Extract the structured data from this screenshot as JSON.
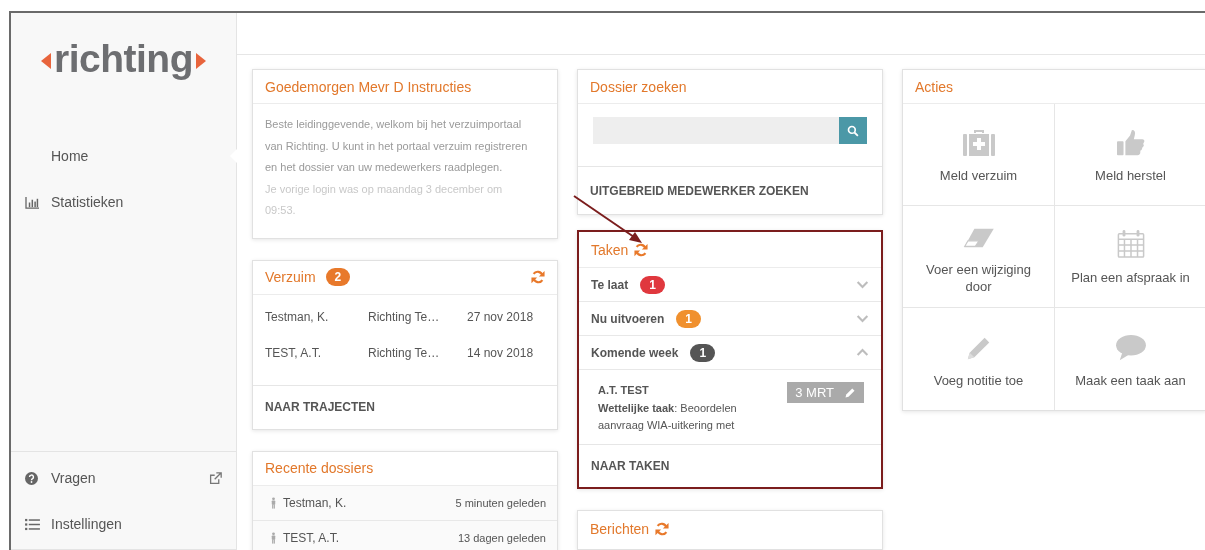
{
  "sidebar": {
    "logo": "richting",
    "nav": [
      {
        "label": "Home",
        "selected": true
      },
      {
        "label": "Statistieken",
        "selected": false
      }
    ],
    "footer": [
      {
        "label": "Vragen",
        "external": true
      },
      {
        "label": "Instellingen",
        "external": false
      }
    ]
  },
  "greeting": {
    "title": "Goedemorgen Mevr D Instructies",
    "text": "Beste leidinggevende, welkom bij het verzuimportaal van Richting. U kunt in het portaal verzuim registreren en het dossier van uw medewerkers raadplegen.",
    "last_login": "Je vorige login was op maandag 3 december om 09:53."
  },
  "verzuim": {
    "title": "Verzuim",
    "count": "2",
    "rows": [
      {
        "name": "Testman, K.",
        "company": "Richting Te…",
        "date": "27 nov 2018"
      },
      {
        "name": "TEST, A.T.",
        "company": "Richting Te…",
        "date": "14 nov 2018"
      }
    ],
    "link": "NAAR TRAJECTEN"
  },
  "recent": {
    "title": "Recente dossiers",
    "items": [
      {
        "name": "Testman, K.",
        "time": "5 minuten geleden"
      },
      {
        "name": "TEST, A.T.",
        "time": "13 dagen geleden"
      }
    ]
  },
  "search": {
    "title": "Dossier zoeken",
    "link": "UITGEBREID MEDEWERKER ZOEKEN"
  },
  "taken": {
    "title": "Taken",
    "highlighted": true,
    "groups": [
      {
        "label": "Te laat",
        "count": "1",
        "color": "#e0383e",
        "expanded": false
      },
      {
        "label": "Nu uitvoeren",
        "count": "1",
        "color": "#f0902e",
        "expanded": false
      },
      {
        "label": "Komende week",
        "count": "1",
        "color": "#555555",
        "expanded": true,
        "tasks": [
          {
            "person": "A.T. TEST",
            "description": "**Wettelijke taak**: Beoordelen aanvraag WIA-uitkering met",
            "date": "3 MRT"
          }
        ]
      }
    ],
    "link": "NAAR TAKEN"
  },
  "berichten": {
    "title": "Berichten"
  },
  "acties": {
    "title": "Acties",
    "items": [
      {
        "label": "Meld verzuim"
      },
      {
        "label": "Meld herstel"
      },
      {
        "label": "Voer een wijziging door"
      },
      {
        "label": "Plan een afspraak in"
      },
      {
        "label": "Voeg notitie toe"
      },
      {
        "label": "Maak een taak aan"
      }
    ]
  }
}
